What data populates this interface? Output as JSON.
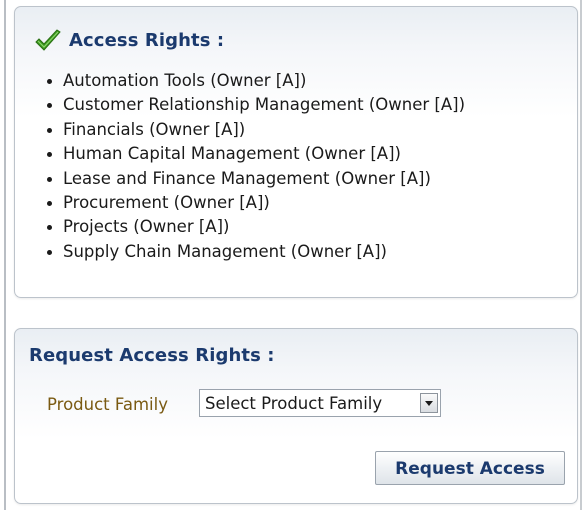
{
  "access_rights": {
    "title": "Access Rights :",
    "icon": "checkmark-icon",
    "items": [
      "Automation Tools (Owner [A])",
      "Customer Relationship Management (Owner [A])",
      "Financials (Owner [A])",
      "Human Capital Management (Owner [A])",
      "Lease and Finance Management (Owner [A])",
      "Procurement (Owner [A])",
      "Projects (Owner [A])",
      "Supply Chain Management (Owner [A])"
    ]
  },
  "request_access": {
    "title": "Request Access Rights :",
    "product_family_label": "Product Family",
    "product_family_selected": "Select Product Family",
    "submit_label": "Request Access"
  },
  "colors": {
    "title": "#1b3a6e",
    "label": "#7a5a12",
    "check": "#3a9a1e"
  }
}
